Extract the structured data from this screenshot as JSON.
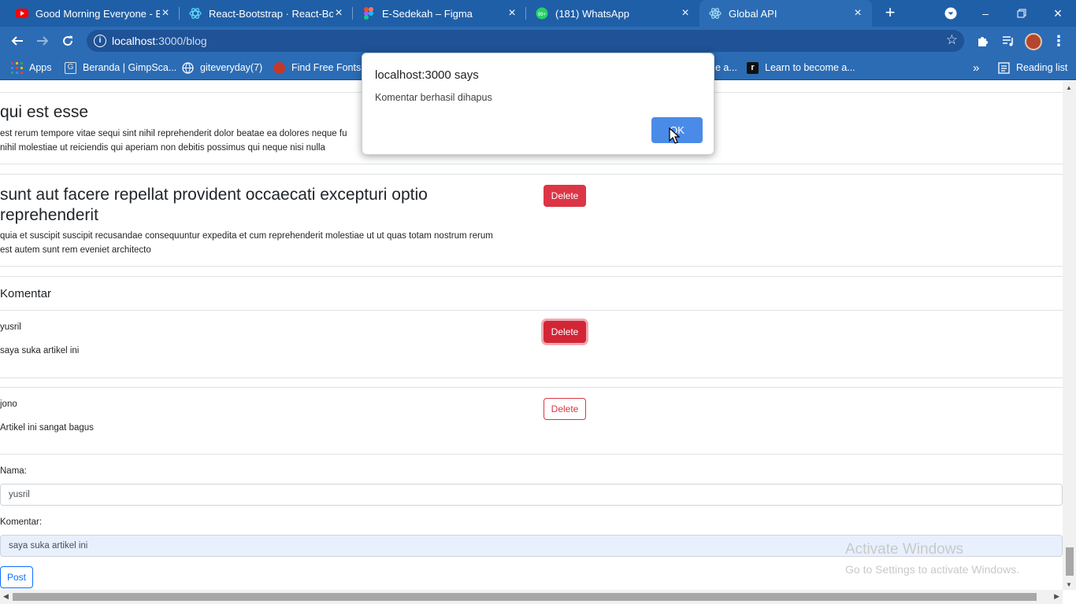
{
  "browser": {
    "tabs": [
      {
        "title": "Good Morning Everyone - Bu",
        "favicon": "youtube-icon",
        "color": "#ff0000"
      },
      {
        "title": "React-Bootstrap · React-Boot",
        "favicon": "react-bootstrap-icon",
        "color": "#61dafb"
      },
      {
        "title": "E-Sedekah – Figma",
        "favicon": "figma-icon",
        "color": "#f24e1e"
      },
      {
        "title": "(181) WhatsApp",
        "favicon": "whatsapp-icon",
        "color": "#25d366"
      },
      {
        "title": "Global API",
        "favicon": "react-icon",
        "color": "#61dafb"
      }
    ],
    "url_host": "localhost",
    "url_path": ":3000/blog",
    "bookmarks": [
      {
        "label": "Apps",
        "icon": "apps-grid-icon",
        "color": "#ea4335"
      },
      {
        "label": "Beranda | GimpSca...",
        "icon": "gimpscape-icon",
        "color": "#e0e0e0"
      },
      {
        "label": "giteveryday(7)",
        "icon": "globe-icon",
        "color": "#ffffff"
      },
      {
        "label": "Find Free Fonts »",
        "icon": "fonts-icon",
        "color": "#c0392b"
      },
      {
        "label": "e a...",
        "icon": "bookmark-icon",
        "color": "#2b6cb5"
      },
      {
        "label": "Learn to become a...",
        "icon": "r-icon",
        "color": "#111111"
      }
    ],
    "bookmarks_overflow": "»",
    "reading_list": "Reading list"
  },
  "posts": [
    {
      "title": "qui est esse",
      "body_line1": "est rerum tempore vitae sequi sint nihil reprehenderit dolor beatae ea dolores neque fu",
      "body_line2": "nihil molestiae ut reiciendis qui aperiam non debitis possimus qui neque nisi nulla"
    },
    {
      "title_line1": "sunt aut facere repellat provident occaecati excepturi optio",
      "title_line2": "reprehenderit",
      "body_line1": "quia et suscipit suscipit recusandae consequuntur expedita et cum reprehenderit molestiae ut ut quas totam nostrum rerum",
      "body_line2": "est autem sunt rem eveniet architecto",
      "delete_label": "Delete"
    }
  ],
  "comments_heading": "Komentar",
  "comments": [
    {
      "name": "yusril",
      "text": "saya suka artikel ini",
      "delete_label": "Delete"
    },
    {
      "name": "jono",
      "text": "Artikel ini sangat bagus",
      "delete_label": "Delete"
    }
  ],
  "form": {
    "name_label": "Nama:",
    "name_value": "yusril",
    "comment_label": "Komentar:",
    "comment_value": "saya suka artikel ini",
    "submit_label": "Post"
  },
  "watermark": {
    "line1": "Activate Windows",
    "line2": "Go to Settings to activate Windows."
  },
  "dialog": {
    "title": "localhost:3000 says",
    "message": "Komentar berhasil dihapus",
    "ok_label": "OK"
  },
  "colors": {
    "chrome_blue": "#2b6cb5",
    "danger": "#dc3545",
    "primary": "#0d6efd",
    "dialog_ok": "#4a8be8"
  }
}
